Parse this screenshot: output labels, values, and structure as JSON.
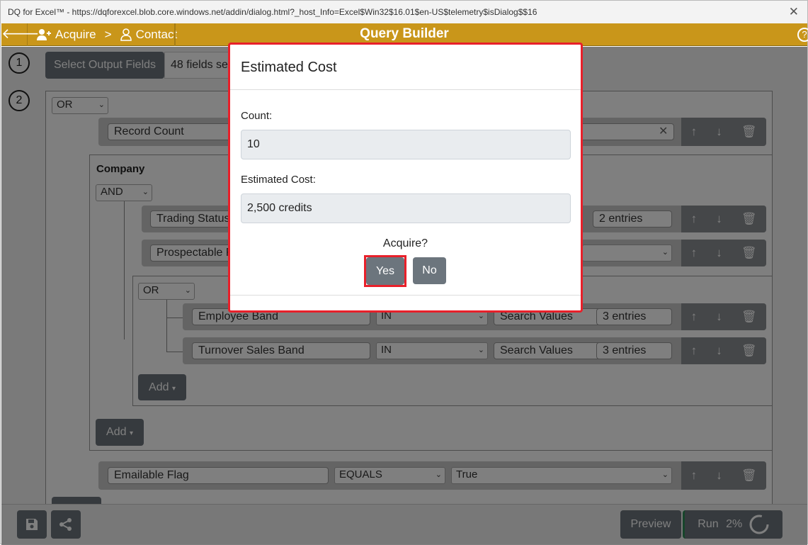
{
  "window": {
    "title": "DQ for Excel™ - https://dqforexcel.blob.core.windows.net/addin/dialog.html?_host_Info=Excel$Win32$16.01$en-US$telemetry$isDialog$$16",
    "close": "✕"
  },
  "appbar": {
    "back": "🡐",
    "crumb_1": "Acquire",
    "crumb_sep": ">",
    "crumb_2": "Contact",
    "title": "Query Builder",
    "help": "?"
  },
  "step1": {
    "number": "1",
    "button": "Select Output Fields",
    "summary": "48 fields se"
  },
  "step2": {
    "number": "2",
    "root_operator": "OR",
    "record_count": {
      "field": "Record Count"
    },
    "company_group": {
      "label": "Company",
      "operator": "AND",
      "rows": [
        {
          "field": "Trading Status",
          "entries": "2 entries"
        },
        {
          "field": "Prospectable F"
        }
      ],
      "subgroup": {
        "operator": "OR",
        "rows": [
          {
            "field": "Employee Band",
            "op": "IN",
            "search": "Search Values",
            "entries": "3 entries"
          },
          {
            "field": "Turnover Sales Band",
            "op": "IN",
            "search": "Search Values",
            "entries": "3 entries"
          }
        ],
        "add_button": "Add"
      },
      "add_button": "Add"
    },
    "emailable": {
      "field": "Emailable Flag",
      "op": "EQUALS",
      "value": "True"
    }
  },
  "actions": {
    "up": "↑",
    "down": "↓",
    "delete": "🗑"
  },
  "footer": {
    "preview": "Preview",
    "run": "Run",
    "progress": "2%"
  },
  "modal": {
    "title": "Estimated Cost",
    "count_label": "Count:",
    "count_value": "10",
    "cost_label": "Estimated Cost:",
    "cost_value": "2,500 credits",
    "question": "Acquire?",
    "yes": "Yes",
    "no": "No"
  },
  "colors": {
    "brand": "#c9961a",
    "button": "#6c757d",
    "highlight": "#e8202a"
  }
}
